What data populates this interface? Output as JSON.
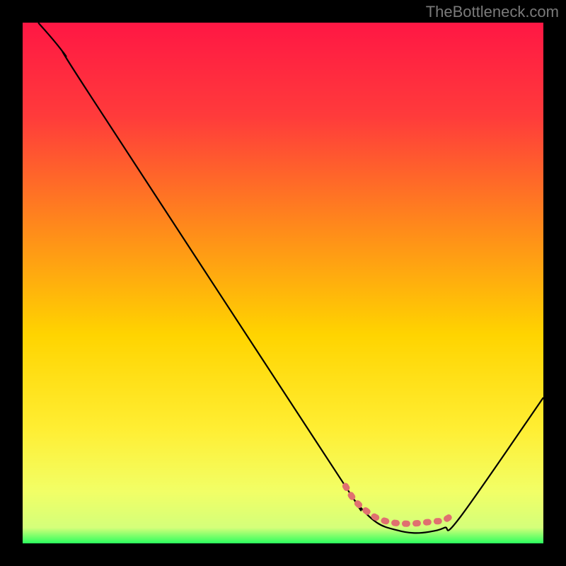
{
  "watermark": "TheBottleneck.com",
  "chart_data": {
    "type": "line",
    "title": "",
    "xlabel": "",
    "ylabel": "",
    "xlim": [
      0,
      100
    ],
    "ylim": [
      0,
      100
    ],
    "gradient_stops": [
      {
        "offset": 0,
        "color": "#ff1744"
      },
      {
        "offset": 18,
        "color": "#ff3b3b"
      },
      {
        "offset": 40,
        "color": "#ff8c1a"
      },
      {
        "offset": 60,
        "color": "#ffd400"
      },
      {
        "offset": 78,
        "color": "#ffee33"
      },
      {
        "offset": 90,
        "color": "#f2ff66"
      },
      {
        "offset": 97,
        "color": "#d4ff7a"
      },
      {
        "offset": 100,
        "color": "#2bff5e"
      }
    ],
    "series": [
      {
        "name": "bottleneck-curve",
        "stroke": "#000000",
        "points": [
          {
            "x": 3,
            "y": 100
          },
          {
            "x": 8,
            "y": 94
          },
          {
            "x": 13,
            "y": 86
          },
          {
            "x": 60,
            "y": 14
          },
          {
            "x": 64,
            "y": 8
          },
          {
            "x": 68,
            "y": 4
          },
          {
            "x": 72,
            "y": 2.5
          },
          {
            "x": 75,
            "y": 2
          },
          {
            "x": 78,
            "y": 2.2
          },
          {
            "x": 81,
            "y": 3
          },
          {
            "x": 84,
            "y": 5
          },
          {
            "x": 100,
            "y": 28
          }
        ]
      },
      {
        "name": "marker-segment",
        "stroke": "#e07070",
        "style": "dashed-thick",
        "points": [
          {
            "x": 62,
            "y": 11
          },
          {
            "x": 64,
            "y": 8
          },
          {
            "x": 67,
            "y": 5.5
          },
          {
            "x": 69,
            "y": 4.5
          },
          {
            "x": 71,
            "y": 4
          },
          {
            "x": 73,
            "y": 3.8
          },
          {
            "x": 75,
            "y": 3.8
          },
          {
            "x": 77,
            "y": 4
          },
          {
            "x": 79,
            "y": 4.2
          },
          {
            "x": 81,
            "y": 4.5
          },
          {
            "x": 83,
            "y": 5.8
          }
        ]
      }
    ]
  }
}
